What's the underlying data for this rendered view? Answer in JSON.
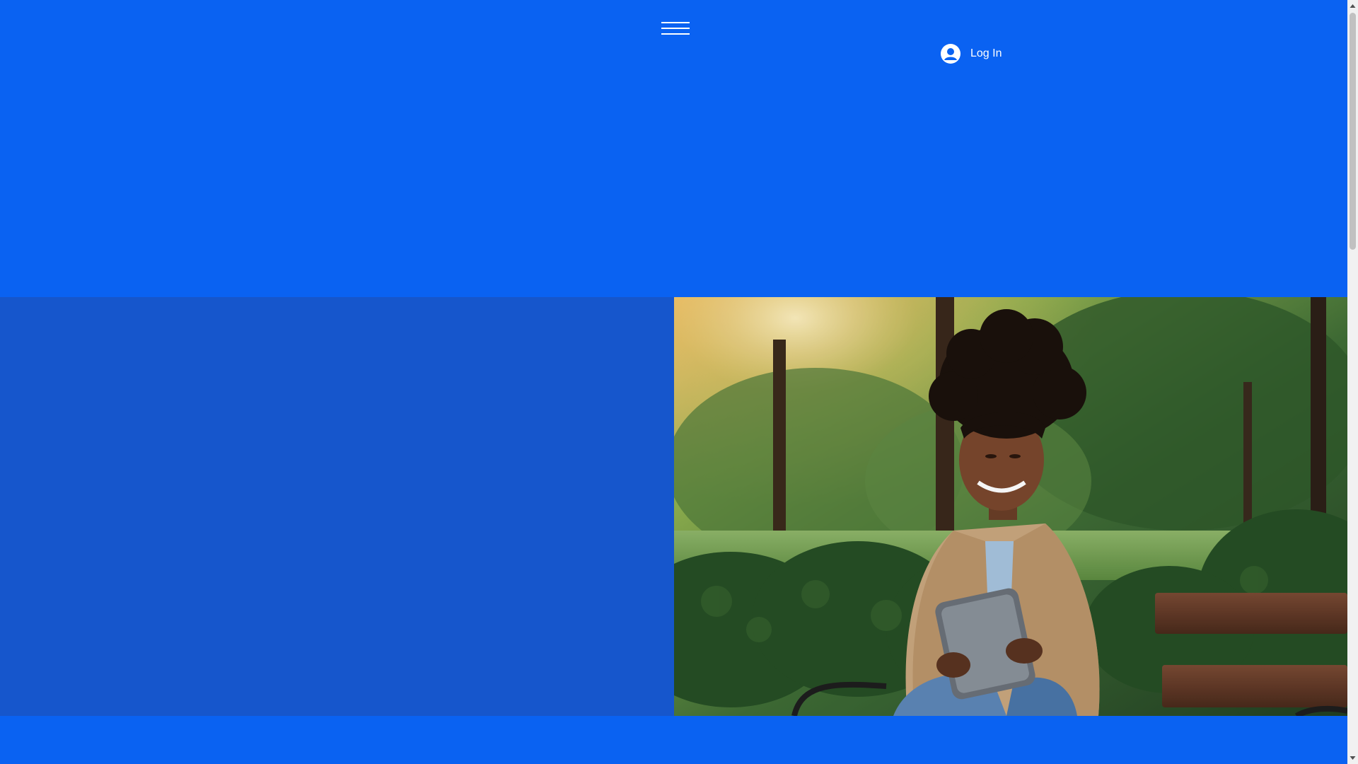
{
  "header": {
    "menu_icon": "hamburger-menu-icon",
    "login": {
      "label": "Log In",
      "icon": "user-avatar-icon"
    }
  },
  "hero": {
    "image": {
      "icon": "photo-woman-tablet-park",
      "description_visible": false
    }
  },
  "colors": {
    "header_bg": "#0a62f2",
    "hero_left_bg": "#1656cc",
    "text": "#ffffff"
  }
}
